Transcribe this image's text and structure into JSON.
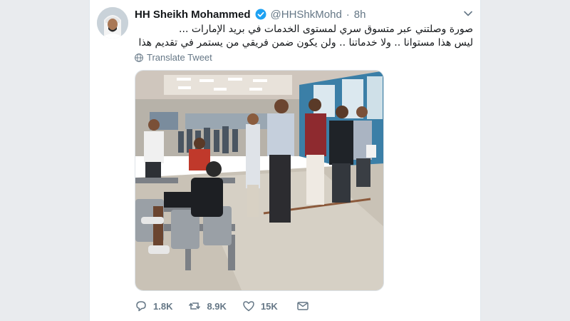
{
  "tweet": {
    "author_name": "HH Sheikh Mohammed",
    "handle": "@HHShkMohd",
    "separator": "·",
    "time": "8h",
    "text_lines": [
      "صورة وصلتني عبر متسوق سري لمستوى الخدمات في بريد الإمارات ...",
      "ليس هذا مستوانا .. ولا خدماتنا .. ولن يكون ضمن فريقي من يستمر في تقديم هذا المستوى .."
    ],
    "translate_label": "Translate Tweet"
  },
  "actions": {
    "replies": "1.8K",
    "retweets": "8.9K",
    "likes": "15K"
  },
  "colors": {
    "verified": "#1da1f2",
    "muted": "#657786",
    "background": "#e9ebee"
  },
  "icons": [
    "verified-badge-icon",
    "chevron-down-icon",
    "globe-icon",
    "reply-icon",
    "retweet-icon",
    "like-icon",
    "message-icon"
  ]
}
